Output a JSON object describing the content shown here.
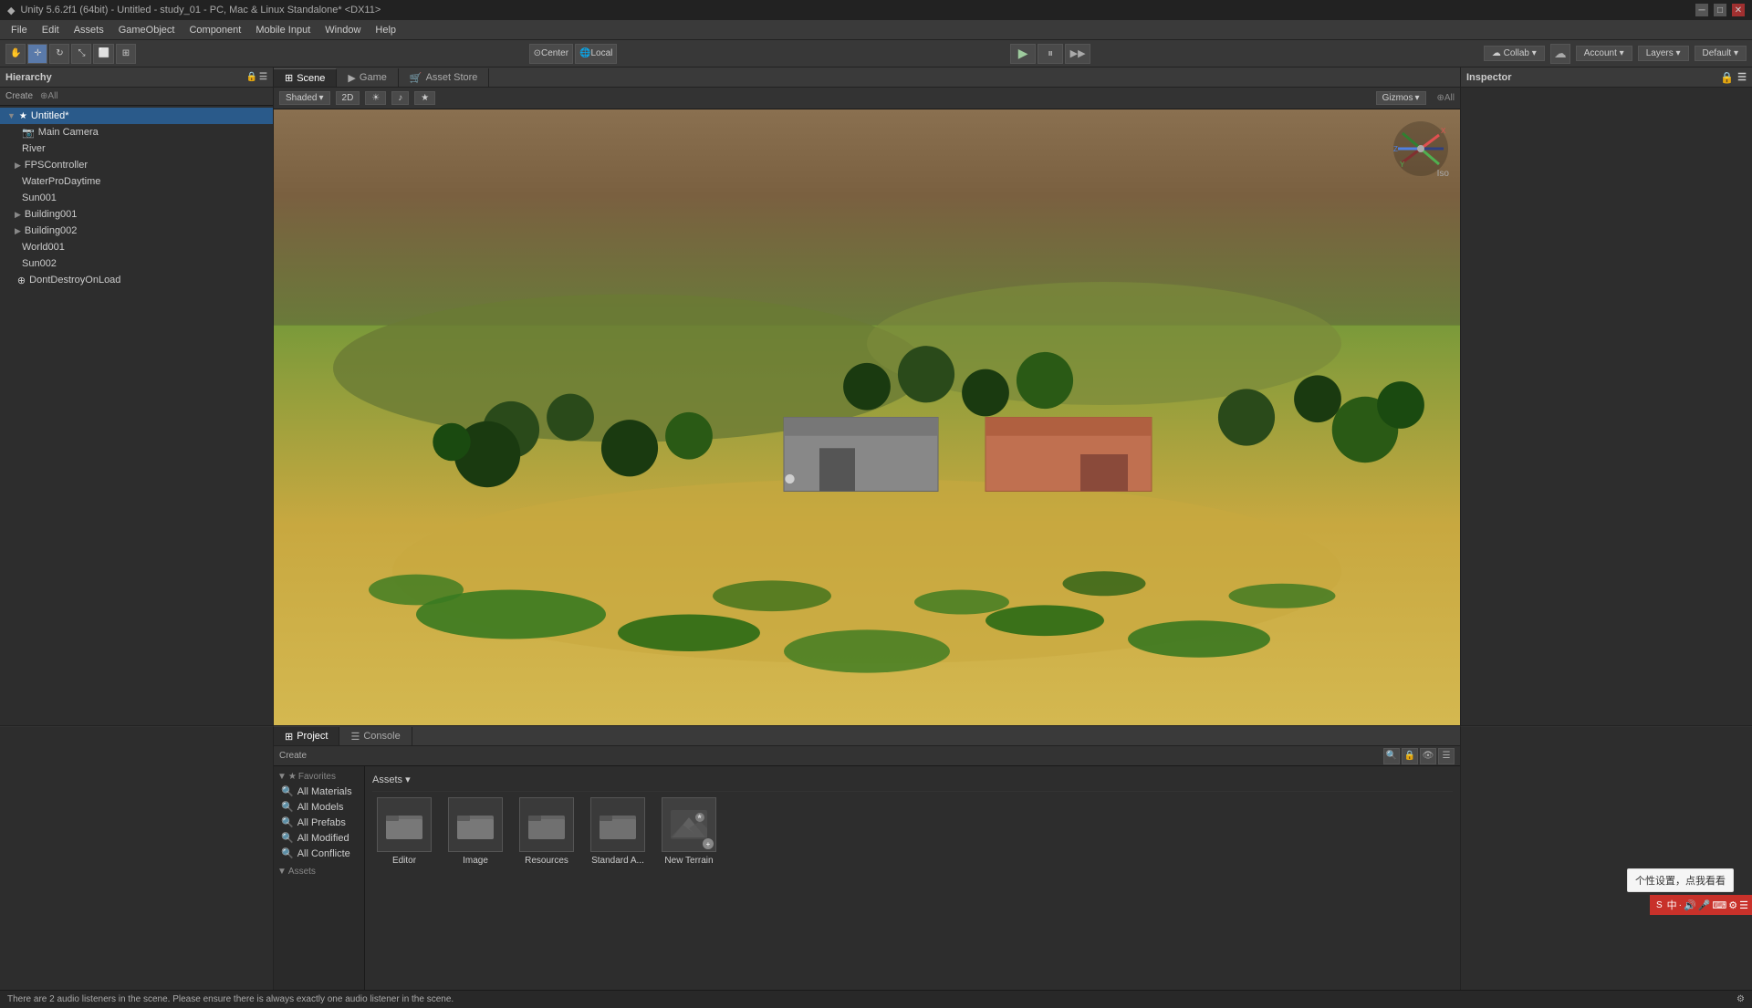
{
  "titlebar": {
    "title": "Unity 5.6.2f1 (64bit) - Untitled - study_01 - PC, Mac & Linux Standalone* <DX11>",
    "unity_label": "Unity",
    "project_name": "Untitled",
    "win_minimize": "─",
    "win_restore": "□",
    "win_close": "✕"
  },
  "menubar": {
    "items": [
      "File",
      "Edit",
      "Assets",
      "GameObject",
      "Component",
      "Mobile Input",
      "Window",
      "Help"
    ]
  },
  "toolbar": {
    "tools": [
      "hand",
      "move",
      "rotate",
      "scale",
      "rect",
      "transform"
    ],
    "pivot_label": "Center",
    "space_label": "Local",
    "play_label": "▶",
    "pause_label": "⏸",
    "step_label": "▶▶",
    "collab_label": "Collab ▾",
    "cloud_icon": "☁",
    "account_label": "Account ▾",
    "layers_label": "Layers ▾",
    "layout_label": "Default ▾"
  },
  "hierarchy": {
    "title": "Hierarchy",
    "create_label": "Create",
    "search_placeholder": "⊕All",
    "items": [
      {
        "name": "Untitled*",
        "level": 0,
        "selected": true,
        "has_children": true,
        "icon": "★"
      },
      {
        "name": "Main Camera",
        "level": 1,
        "has_children": false,
        "icon": "📷"
      },
      {
        "name": "River",
        "level": 1,
        "has_children": false,
        "icon": ""
      },
      {
        "name": "FPSController",
        "level": 1,
        "has_children": true,
        "icon": ""
      },
      {
        "name": "WaterProDaytime",
        "level": 1,
        "has_children": false,
        "icon": ""
      },
      {
        "name": "Sun001",
        "level": 1,
        "has_children": false,
        "icon": ""
      },
      {
        "name": "Building001",
        "level": 1,
        "has_children": true,
        "icon": ""
      },
      {
        "name": "Building002",
        "level": 1,
        "has_children": true,
        "icon": ""
      },
      {
        "name": "World001",
        "level": 1,
        "has_children": false,
        "icon": ""
      },
      {
        "name": "Sun002",
        "level": 1,
        "has_children": false,
        "icon": ""
      },
      {
        "name": "DontDestroyOnLoad",
        "level": 0,
        "has_children": false,
        "icon": "⊕"
      }
    ]
  },
  "scene": {
    "tabs": [
      {
        "name": "Scene",
        "active": true
      },
      {
        "name": "Game",
        "active": false
      },
      {
        "name": "Asset Store",
        "active": false
      }
    ],
    "shading_label": "Shaded",
    "mode_label": "2D",
    "gizmos_label": "Gizmos",
    "gizmos_search": "⊕All",
    "iso_label": "Iso"
  },
  "inspector": {
    "title": "Inspector",
    "lock_icon": "🔒"
  },
  "project": {
    "tabs": [
      {
        "name": "Project",
        "active": true
      },
      {
        "name": "Console",
        "active": false
      }
    ],
    "create_label": "Create",
    "search_placeholder": "",
    "favorites": {
      "title": "Favorites",
      "items": [
        {
          "name": "All Materials",
          "icon": "🔍"
        },
        {
          "name": "All Models",
          "icon": "🔍"
        },
        {
          "name": "All Prefabs",
          "icon": "🔍"
        },
        {
          "name": "All Modified",
          "icon": "🔍"
        },
        {
          "name": "All Conflicte",
          "icon": "🔍"
        }
      ]
    },
    "assets": {
      "title": "Assets",
      "items": [
        {
          "name": "Assets",
          "is_folder": true
        }
      ]
    },
    "assets_header": "Assets ▾",
    "files": [
      {
        "name": "Editor",
        "type": "folder"
      },
      {
        "name": "Image",
        "type": "folder"
      },
      {
        "name": "Resources",
        "type": "folder"
      },
      {
        "name": "Standard A...",
        "type": "folder"
      },
      {
        "name": "New Terrain",
        "type": "terrain"
      }
    ]
  },
  "statusbar": {
    "message": "There are 2 audio listeners in the scene. Please ensure there is always exactly one audio listener in the scene.",
    "right_icon": "⚙"
  },
  "colors": {
    "selected_bg": "#2a5a8a",
    "panel_bg": "#2d2d2d",
    "toolbar_bg": "#383838",
    "header_bg": "#3a3a3a",
    "accent": "#5a7aaa"
  }
}
